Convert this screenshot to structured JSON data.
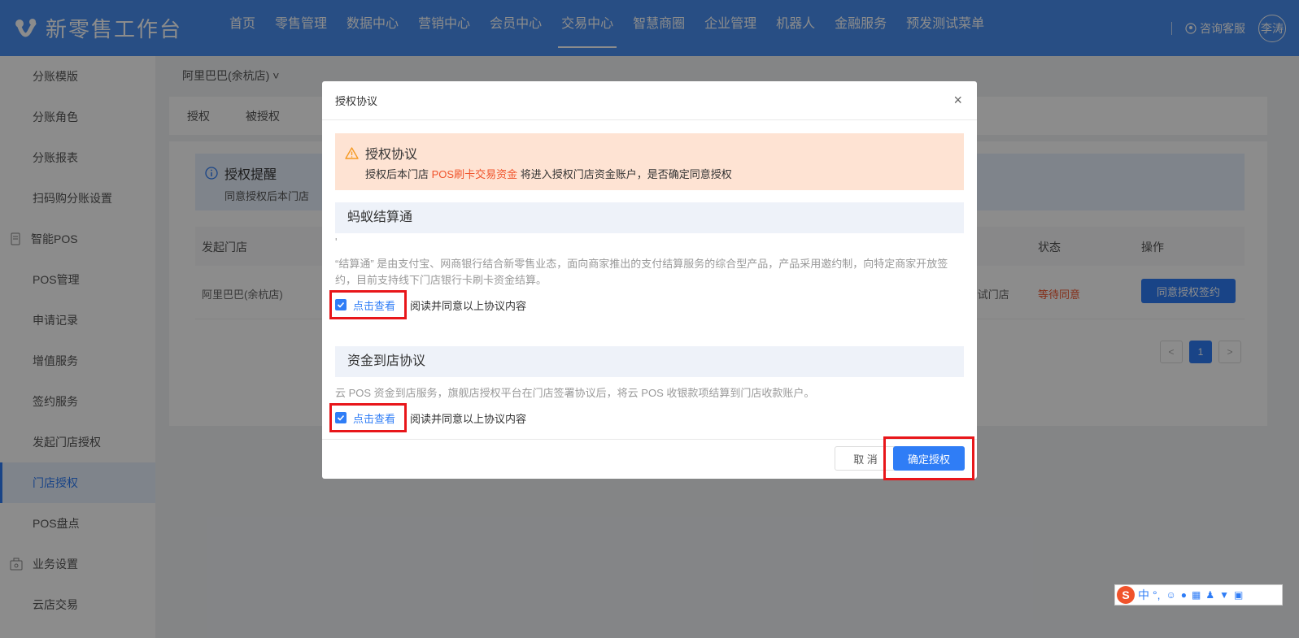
{
  "app": {
    "title": "新零售工作台"
  },
  "nav": {
    "items": [
      "首页",
      "零售管理",
      "数据中心",
      "营销中心",
      "会员中心",
      "交易中心",
      "智慧商圈",
      "企业管理",
      "机器人",
      "金融服务",
      "预发测试菜单"
    ],
    "active_index": 5
  },
  "header": {
    "support_label": "咨询客服",
    "user_name": "李涛"
  },
  "sidebar": {
    "items": [
      {
        "label": "分账模版",
        "type": "item"
      },
      {
        "label": "分账角色",
        "type": "item"
      },
      {
        "label": "分账报表",
        "type": "item"
      },
      {
        "label": "扫码购分账设置",
        "type": "item"
      },
      {
        "label": "智能POS",
        "type": "group",
        "icon": "pos-icon"
      },
      {
        "label": "POS管理",
        "type": "item"
      },
      {
        "label": "申请记录",
        "type": "item"
      },
      {
        "label": "增值服务",
        "type": "item"
      },
      {
        "label": "签约服务",
        "type": "item"
      },
      {
        "label": "发起门店授权",
        "type": "item"
      },
      {
        "label": "门店授权",
        "type": "item",
        "active": true
      },
      {
        "label": "POS盘点",
        "type": "item"
      },
      {
        "label": "业务设置",
        "type": "group",
        "icon": "settings-box-icon"
      },
      {
        "label": "云店交易",
        "type": "item"
      }
    ]
  },
  "main": {
    "store_select": "阿里巴巴(余杭店) ˅",
    "tabs": [
      "授权",
      "被授权"
    ],
    "notice": {
      "title": "授权提醒",
      "text": "同意授权后本门店 "
    },
    "table": {
      "headers": {
        "store": "发起门店",
        "status": "状态",
        "action": "操作"
      },
      "row": {
        "store": "阿里巴巴(余杭店)",
        "target": "OS测试门店",
        "status": "等待同意",
        "action": "同意授权签约"
      }
    },
    "pagination": {
      "prev": "<",
      "current": "1",
      "next": ">"
    }
  },
  "modal": {
    "title": "授权协议",
    "close": "×",
    "warning": {
      "title": "授权协议",
      "text_before": "授权后本门店 ",
      "highlight": "POS刷卡交易资金",
      "text_after": " 将进入授权门店资金账户，是否确定同意授权"
    },
    "sections": [
      {
        "title": "蚂蚁结算通",
        "mark": "'",
        "description": "“结算通” 是由支付宝、网商银行结合新零售业态，面向商家推出的支付结算服务的综合型产品，产品采用邀约制，向特定商家开放签约，目前支持线下门店银行卡刷卡资金结算。",
        "link": "点击查看",
        "agree": "阅读并同意以上协议内容",
        "checked": true
      },
      {
        "title": "资金到店协议",
        "description": "云 POS 资金到店服务，旗舰店授权平台在门店签署协议后，将云 POS 收银款项结算到门店收款账户。",
        "link": "点击查看",
        "agree": "阅读并同意以上协议内容",
        "checked": true
      }
    ],
    "cancel": "取 消",
    "confirm": "确定授权"
  },
  "ime": {
    "logo": "S",
    "mode": "中",
    "punct": "°,",
    "icons": [
      "emoji-icon",
      "mic-icon",
      "keyboard-icon",
      "user-icon",
      "shirt-icon",
      "grid-icon"
    ]
  },
  "colors": {
    "primary": "#2f7df6",
    "topbar": "#4a8ff0",
    "warning_bg": "#fee3d3",
    "highlight": "#f0532b",
    "annotation": "#e8161a"
  }
}
